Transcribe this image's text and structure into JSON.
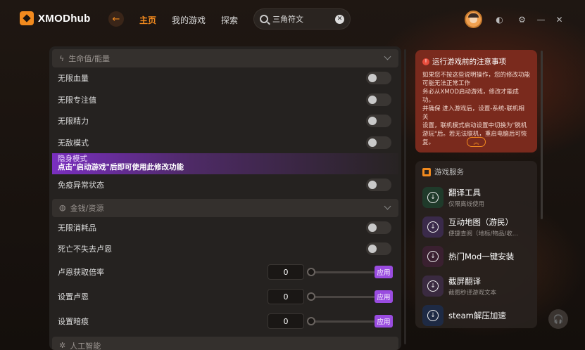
{
  "app": {
    "brand": "XMODhub"
  },
  "nav": {
    "items": [
      "主页",
      "我的游戏",
      "探索"
    ],
    "active_index": 0
  },
  "search": {
    "value": "三角符文"
  },
  "sections": {
    "vitals": {
      "title": "生命值/能量",
      "toggles": [
        "无限血量",
        "无限专注值",
        "无限精力",
        "无敌模式"
      ],
      "highlight": {
        "title": "隐身模式",
        "note": "点击\"启动游戏\"后即可使用此修改功能"
      },
      "after_toggles": [
        "免疫异常状态"
      ]
    },
    "money": {
      "title": "金钱/资源",
      "toggles": [
        "无限消耗品",
        "死亡不失去卢恩"
      ],
      "inputs": [
        {
          "label": "卢恩获取倍率",
          "value": "0",
          "apply": "应用"
        },
        {
          "label": "设置卢恩",
          "value": "0",
          "apply": "应用"
        },
        {
          "label": "设置暗痕",
          "value": "0",
          "apply": "应用"
        }
      ]
    },
    "ai": {
      "title": "人工智能"
    }
  },
  "notice": {
    "title": "运行游戏前的注意事项",
    "lines": [
      "如果您不按这些说明操作，您的修改功能",
      "可能无法正常工作",
      "务必从XMOD启动游戏，修改才能成功。",
      "并确保 进入游戏后，设置-系统-联机相关",
      "设置，联机模式启动设置中切换为\"脱机",
      "游玩\"后。若无法联机，重启电脑后可恢",
      "复。"
    ]
  },
  "services": {
    "title": "游戏服务",
    "items": [
      {
        "name": "翻译工具",
        "sub": "仅限离线使用",
        "color": "#1f3a2a"
      },
      {
        "name": "互动地图（游民）",
        "sub": "便捷查阅（地标/物品/收...",
        "color": "#3a2a4a"
      },
      {
        "name": "热门Mod一键安装",
        "sub": "",
        "color": "#3a2030"
      },
      {
        "name": "截屏翻译",
        "sub": "截图秒译游戏文本",
        "color": "#3a2a40"
      },
      {
        "name": "steam解压加速",
        "sub": "",
        "color": "#1e2a44"
      }
    ]
  },
  "colors": {
    "accent": "#f28a1e",
    "apply": "#9a4ce0",
    "notice_bg": "#7a2a1d"
  }
}
